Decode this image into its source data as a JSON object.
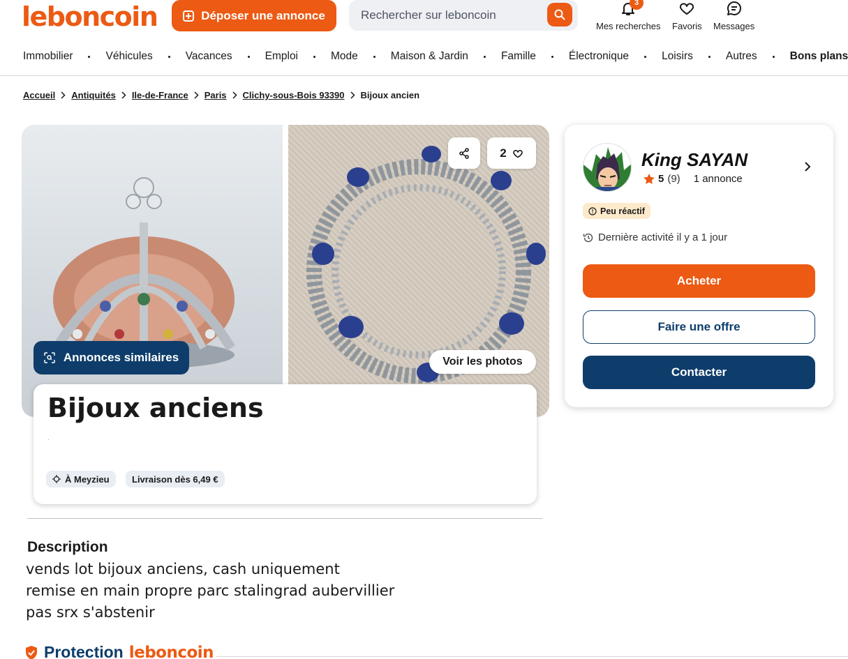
{
  "header": {
    "logo": "leboncoin",
    "deposit_label": "Déposer une annonce",
    "search_placeholder": "Rechercher sur leboncoin",
    "my_searches": {
      "label": "Mes recherches",
      "badge": "3"
    },
    "favorites": {
      "label": "Favoris"
    },
    "messages": {
      "label": "Messages"
    }
  },
  "categories": [
    "Immobilier",
    "Véhicules",
    "Vacances",
    "Emploi",
    "Mode",
    "Maison & Jardin",
    "Famille",
    "Électronique",
    "Loisirs",
    "Autres"
  ],
  "categories_highlight": "Bons plans !",
  "breadcrumb": {
    "links": [
      "Accueil",
      "Antiquités",
      "Ile-de-France",
      "Paris",
      "Clichy-sous-Bois 93390"
    ],
    "current": "Bijoux ancien"
  },
  "gallery": {
    "similar_label": "Annonces similaires",
    "favorites_count": "2",
    "view_photos_label": "Voir les photos"
  },
  "listing": {
    "title": "Bijoux anciens",
    "tiny_mark": "´",
    "location_chip": "À Meyzieu",
    "delivery_chip": "Livraison dès 6,49 €"
  },
  "description": {
    "heading": "Description",
    "lines": [
      "vends lot bijoux anciens, cash uniquement",
      "remise en main propre parc stalingrad aubervillier",
      "pas srx s'abstenir"
    ]
  },
  "protection": {
    "part1": "Protection",
    "part2": "leboncoin"
  },
  "seller": {
    "name": "King SAYAN",
    "rating_score": "5",
    "rating_count": "(9)",
    "ads_count": "1 annonce",
    "status": "Peu réactif",
    "last_activity": "Dernière activité il y a 1 jour",
    "buy_label": "Acheter",
    "offer_label": "Faire une offre",
    "contact_label": "Contacter"
  },
  "colors": {
    "brand_orange": "#ec5a13",
    "brand_navy": "#0e3d6b",
    "status_pill_bg": "#fdeacb",
    "chip_bg": "#e9eef4"
  }
}
